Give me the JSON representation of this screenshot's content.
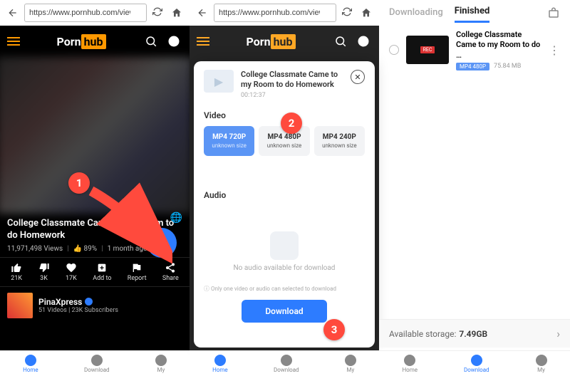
{
  "url": "https://www.pornhub.com/view_video.php?vi",
  "logo": {
    "p1": "Porn",
    "p2": "hub"
  },
  "video": {
    "title": "College Classmate Came to my Room to do Homework",
    "title_short": "College Classmate Came to my Room to do Homework",
    "views": "11,971,498 Views",
    "like_pct": "89%",
    "age": "1 month ago",
    "duration": "00:12:37"
  },
  "actions": {
    "like": "21K",
    "dislike": "3K",
    "fav": "17K",
    "add": "Add to",
    "report": "Report",
    "share": "Share"
  },
  "channel": {
    "name": "PinaXpress",
    "sub": "51 Videos | 23K Subscribers"
  },
  "bottomnav": {
    "home": "Home",
    "download": "Download",
    "my": "My"
  },
  "sheet": {
    "video_label": "Video",
    "audio_label": "Audio",
    "opts": [
      {
        "label": "MP4 720P",
        "size": "unknown size"
      },
      {
        "label": "MP4 480P",
        "size": "unknown size"
      },
      {
        "label": "MP4 240P",
        "size": "unknown size"
      }
    ],
    "noaudio": "No audio available for download",
    "hint": "Only one video or audio can selected to download",
    "download": "Download"
  },
  "downloads": {
    "tab_downloading": "Downloading",
    "tab_finished": "Finished",
    "item_title": "College Classmate Came to my Room to do …",
    "badge": "MP4 480P",
    "size": "75.84 MB",
    "rec": "REC",
    "storage_label": "Available storage:",
    "storage_value": "7.49GB"
  },
  "callouts": {
    "c1": "1",
    "c2": "2",
    "c3": "3"
  }
}
